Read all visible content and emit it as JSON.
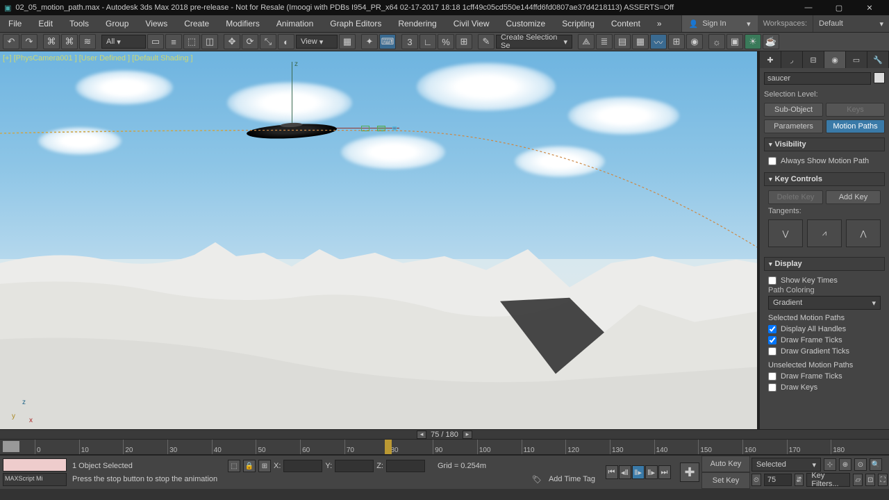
{
  "title": "02_05_motion_path.max - Autodesk 3ds Max 2018 pre-release - Not for Resale (Imoogi with PDBs I954_PR_x64 02-17-2017 18:18 1cff49c05cd550e144ffd6fd0807ae37d4218113) ASSERTS=Off",
  "menu": [
    "File",
    "Edit",
    "Tools",
    "Group",
    "Views",
    "Create",
    "Modifiers",
    "Animation",
    "Graph Editors",
    "Rendering",
    "Civil View",
    "Customize",
    "Scripting",
    "Content"
  ],
  "signin": "Sign In",
  "workspaces_label": "Workspaces:",
  "workspace": "Default",
  "toolbar": {
    "filter": "All",
    "viewmode": "View",
    "selset": "Create Selection Se"
  },
  "viewport_label": "[+] [PhysCamera001 ] [User Defined ] [Default Shading ]",
  "axis": {
    "z": "z",
    "y": "y",
    "x": "x"
  },
  "panel": {
    "object_name": "saucer",
    "selection_level": "Selection Level:",
    "subobject": "Sub-Object",
    "keys": "Keys",
    "parameters": "Parameters",
    "motionpaths": "Motion Paths",
    "visibility": "Visibility",
    "always_show": "Always Show Motion Path",
    "keycontrols": "Key Controls",
    "deletekey": "Delete Key",
    "addkey": "Add Key",
    "tangents": "Tangents:",
    "display": "Display",
    "showkeytimes": "Show Key Times",
    "pathcoloring": "Path Coloring",
    "gradient": "Gradient",
    "sel_mp": "Selected Motion Paths",
    "disp_all": "Display All Handles",
    "draw_ft": "Draw Frame Ticks",
    "draw_gt": "Draw Gradient Ticks",
    "unsel_mp": "Unselected Motion Paths",
    "u_draw_ft": "Draw Frame Ticks",
    "u_draw_k": "Draw Keys"
  },
  "trackbar": {
    "frame": "75 / 180"
  },
  "timeline": {
    "ticks": [
      "0",
      "10",
      "20",
      "30",
      "40",
      "50",
      "60",
      "70",
      "80",
      "90",
      "100",
      "110",
      "120",
      "130",
      "140",
      "150",
      "160",
      "170",
      "180"
    ]
  },
  "status": {
    "maxscript": "MAXScript Mi",
    "selected": "1 Object Selected",
    "hint": "Press the stop button to stop the animation",
    "x": "X:",
    "y": "Y:",
    "z": "Z:",
    "grid": "Grid = 0.254m",
    "addtag": "Add Time Tag",
    "autokey": "Auto Key",
    "setkey": "Set Key",
    "selectedlab": "Selected",
    "keyfilters": "Key Filters...",
    "curframe": "75"
  }
}
